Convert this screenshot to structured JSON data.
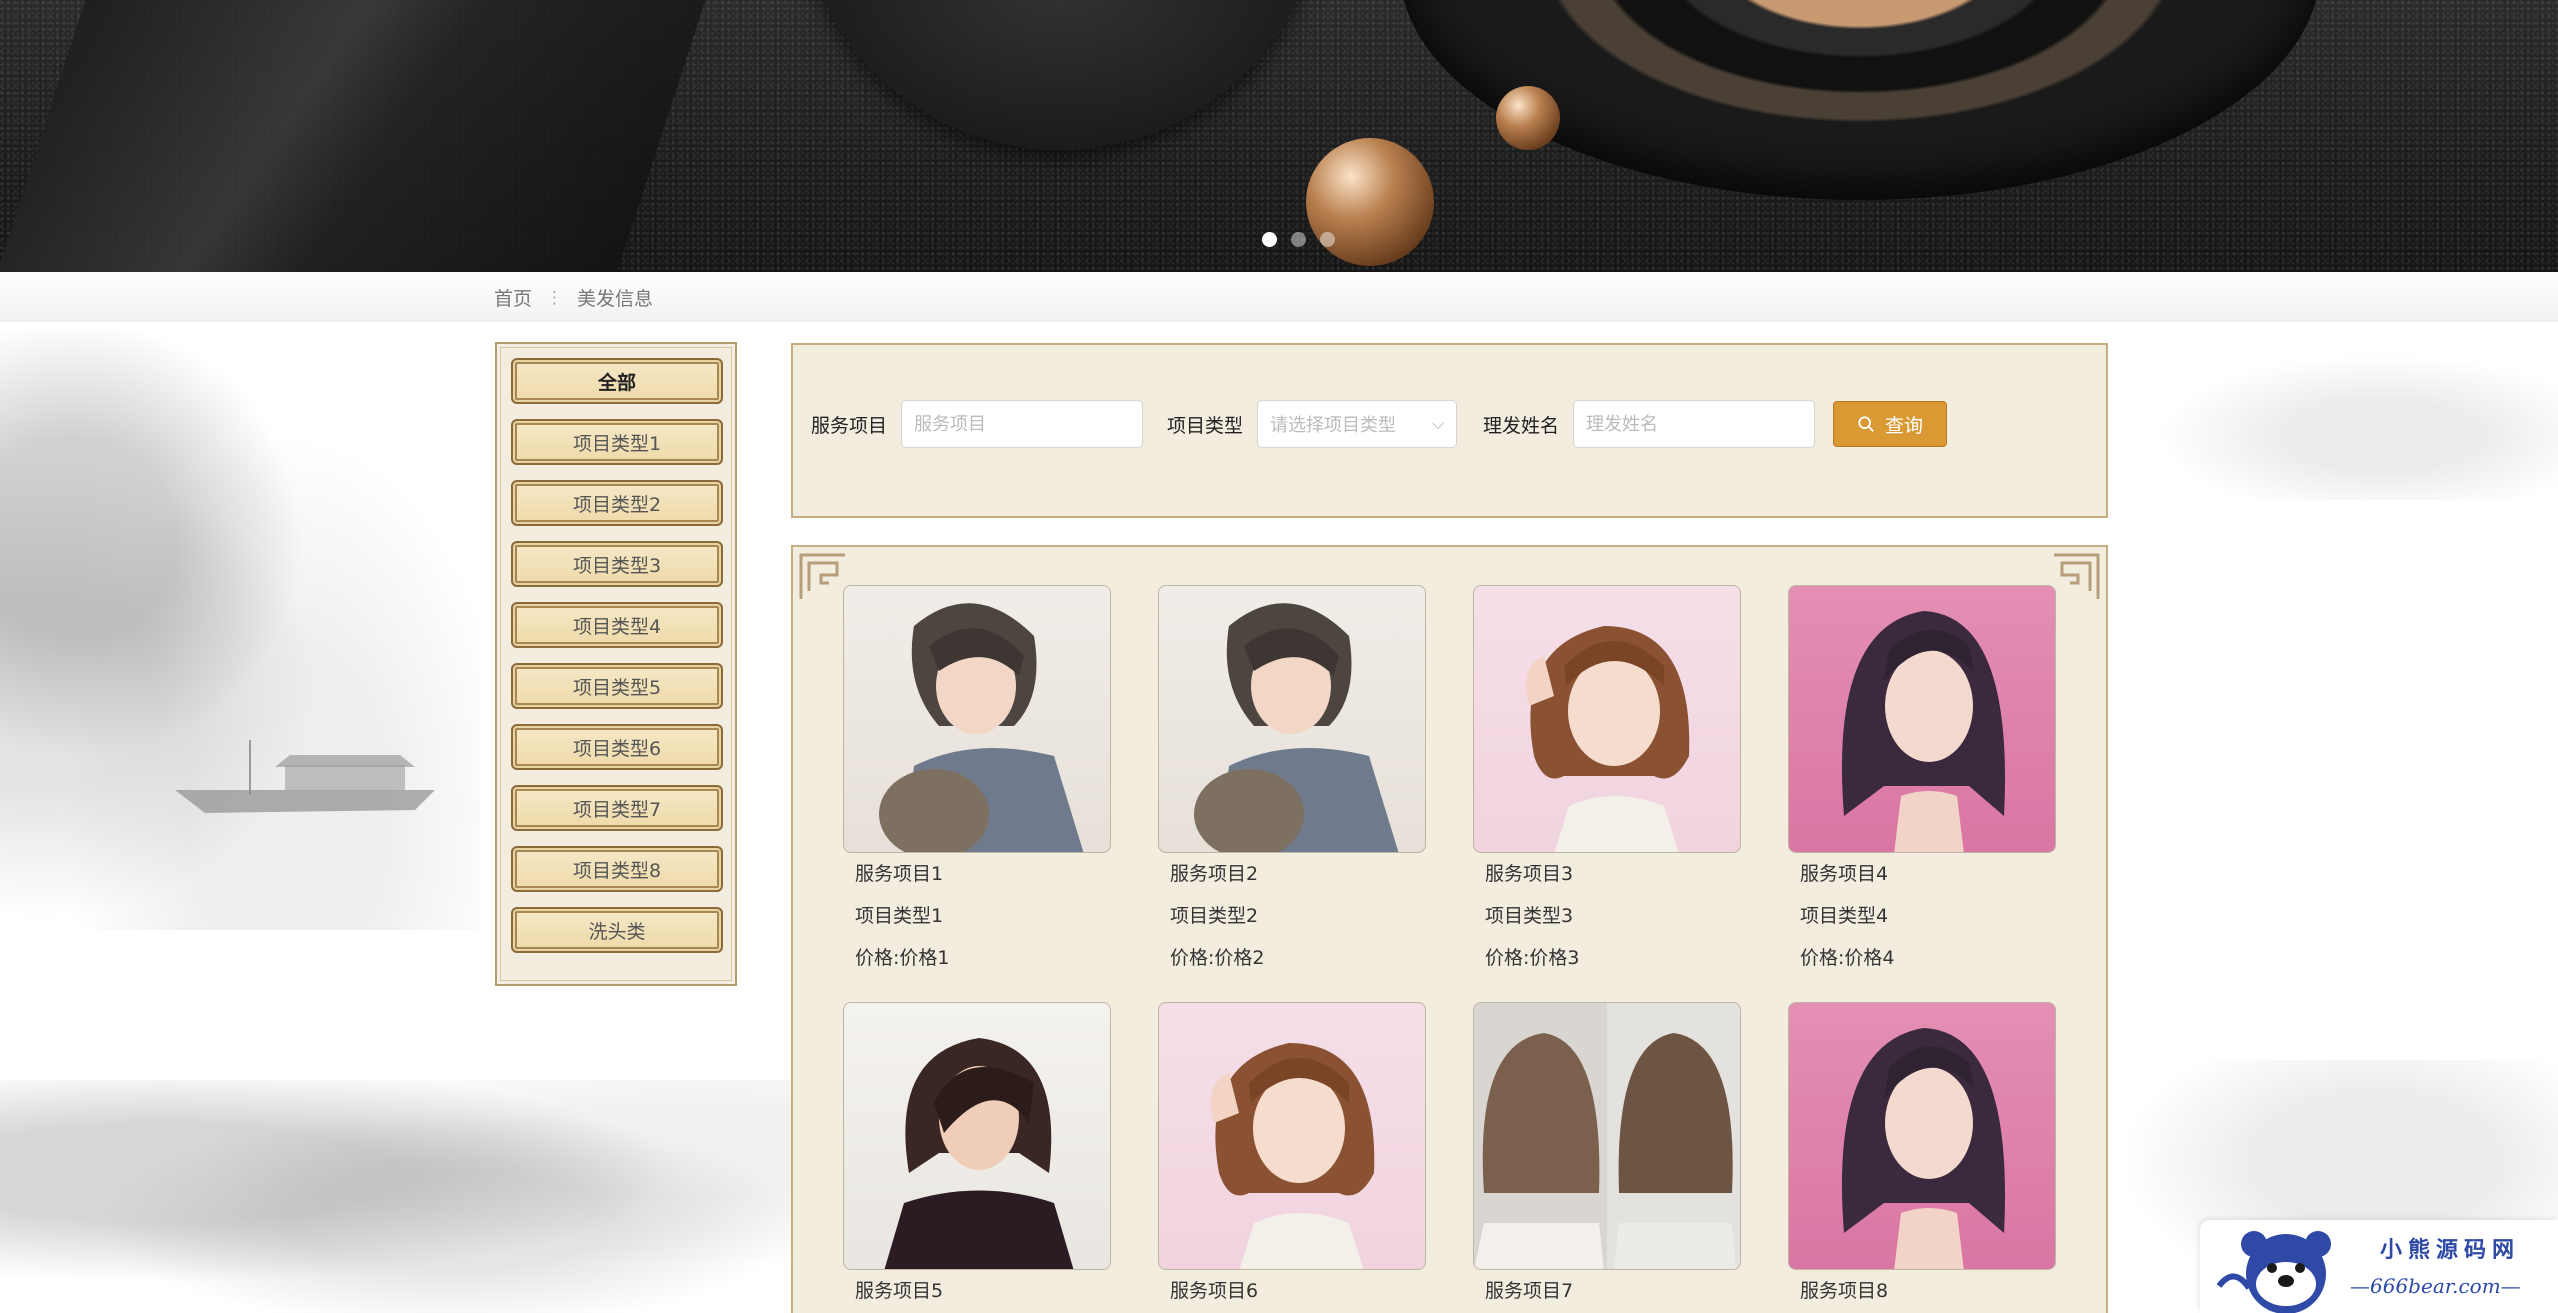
{
  "banner": {
    "slides": [
      {
        "label": ""
      },
      {
        "label": ""
      },
      {
        "label": ""
      }
    ],
    "active_slide": 1
  },
  "breadcrumb": {
    "home": "首页",
    "current": "美发信息"
  },
  "categories": [
    "全部",
    "项目类型1",
    "项目类型2",
    "项目类型3",
    "项目类型4",
    "项目类型5",
    "项目类型6",
    "项目类型7",
    "项目类型8",
    "洗头类"
  ],
  "search": {
    "service_label": "服务项目",
    "service_placeholder": "服务项目",
    "type_label": "项目类型",
    "type_placeholder": "请选择项目类型",
    "barber_label": "理发姓名",
    "barber_placeholder": "理发姓名",
    "button_label": "查询"
  },
  "products": [
    {
      "name": "服务项目1",
      "type": "项目类型1",
      "price": "价格:价格1"
    },
    {
      "name": "服务项目2",
      "type": "项目类型2",
      "price": "价格:价格2"
    },
    {
      "name": "服务项目3",
      "type": "项目类型3",
      "price": "价格:价格3"
    },
    {
      "name": "服务项目4",
      "type": "项目类型4",
      "price": "价格:价格4"
    },
    {
      "name": "服务项目5"
    },
    {
      "name": "服务项目6"
    },
    {
      "name": "服务项目7"
    },
    {
      "name": "服务项目8"
    }
  ],
  "watermark": {
    "title": "小熊源码网",
    "url": "—666bear.com—"
  },
  "colors": {
    "accent": "#d99a33",
    "panel_bg": "#f3ede0",
    "panel_border": "#c6ad7f",
    "watermark_blue": "#2e4aa6"
  }
}
